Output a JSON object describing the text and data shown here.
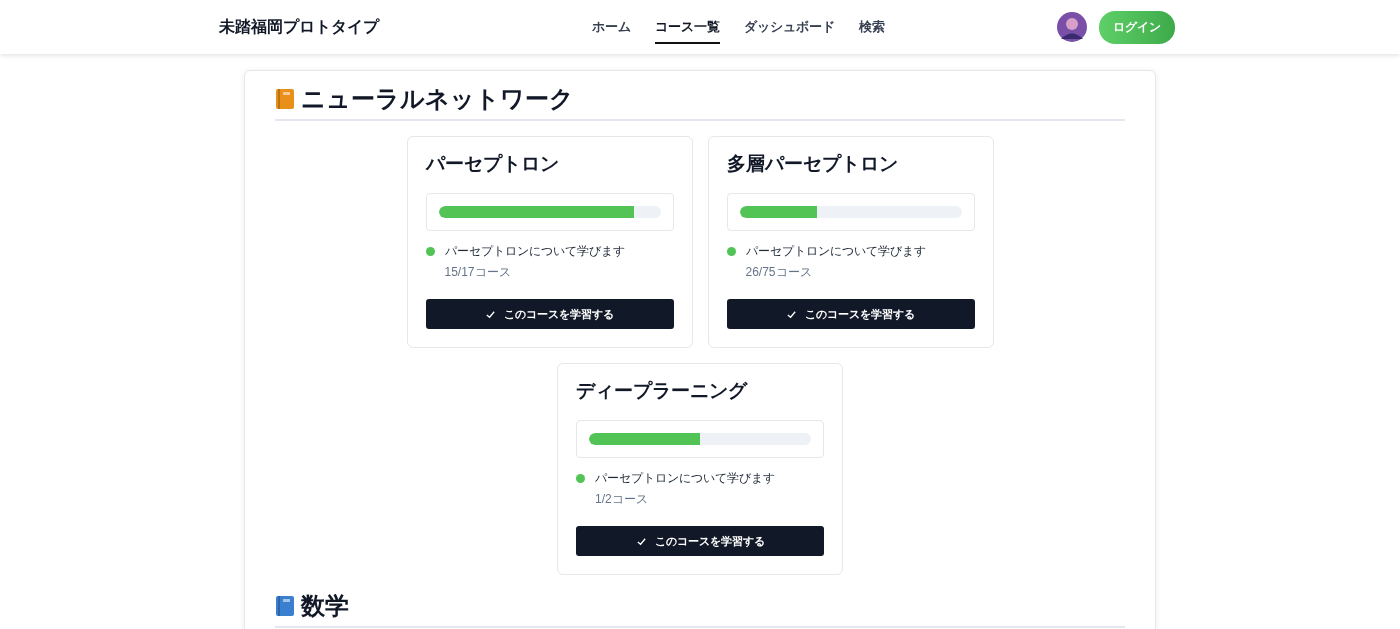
{
  "header": {
    "brand": "未踏福岡プロトタイプ",
    "nav": [
      {
        "label": "ホーム",
        "selected": false
      },
      {
        "label": "コース一覧",
        "selected": true
      },
      {
        "label": "ダッシュボード",
        "selected": false
      },
      {
        "label": "検索",
        "selected": false
      }
    ],
    "login_button": "ログイン"
  },
  "sections": [
    {
      "title": "ニューラルネットワーク",
      "color": "#e8901a",
      "courses": [
        {
          "title": "パーセプトロン",
          "level": 0.88,
          "description": "パーセプトロンについて学びます",
          "count": "15/17コース",
          "button": "このコースを学習する"
        },
        {
          "title": "多層パーセプトロン",
          "level": 0.35,
          "description": "パーセプトロンについて学びます",
          "count": "26/75コース",
          "button": "このコースを学習する"
        },
        {
          "title": "ディープラーニング",
          "level": 0.5,
          "description": "パーセプトロンについて学びます",
          "count": "1/2コース",
          "button": "このコースを学習する"
        }
      ]
    },
    {
      "title": "数学",
      "color": "#3b7fd0"
    }
  ]
}
